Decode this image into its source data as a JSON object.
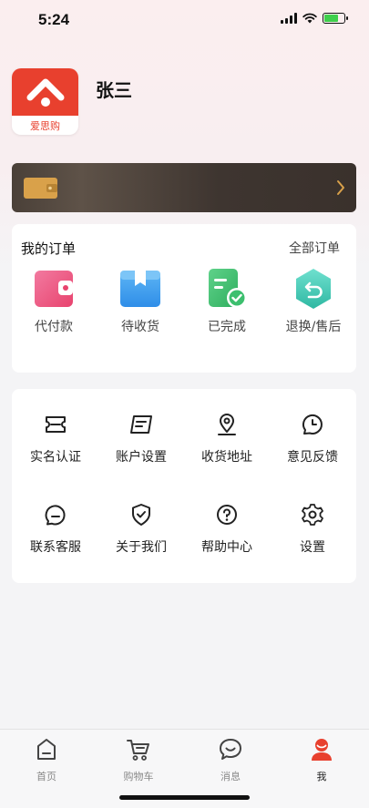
{
  "status_bar": {
    "time": "5:24"
  },
  "profile": {
    "avatar_text": "爱思购",
    "name": "张三"
  },
  "orders": {
    "title": "我的订单",
    "all_label": "全部订单",
    "items": [
      {
        "label": "代付款",
        "icon": "wallet-icon"
      },
      {
        "label": "待收货",
        "icon": "package-icon"
      },
      {
        "label": "已完成",
        "icon": "completed-icon"
      },
      {
        "label": "退换/售后",
        "icon": "return-icon"
      }
    ]
  },
  "services": {
    "items": [
      {
        "label": "实名认证",
        "icon": "id-card-icon"
      },
      {
        "label": "账户设置",
        "icon": "account-settings-icon"
      },
      {
        "label": "收货地址",
        "icon": "location-icon"
      },
      {
        "label": "意见反馈",
        "icon": "clock-icon"
      },
      {
        "label": "联系客服",
        "icon": "chat-icon"
      },
      {
        "label": "关于我们",
        "icon": "shield-icon"
      },
      {
        "label": "帮助中心",
        "icon": "help-icon"
      },
      {
        "label": "设置",
        "icon": "gear-icon"
      }
    ]
  },
  "tab_bar": {
    "items": [
      {
        "label": "首页",
        "icon": "home-icon"
      },
      {
        "label": "购物车",
        "icon": "cart-icon"
      },
      {
        "label": "消息",
        "icon": "message-icon"
      },
      {
        "label": "我",
        "icon": "user-icon"
      }
    ],
    "active": "我"
  },
  "colors": {
    "brand_red": "#e8402e",
    "wallet_gold": "#d9a14a",
    "order_pink": "#ec4f7a",
    "order_blue": "#2f8ee8",
    "order_green": "#3cbf6e",
    "order_teal": "#3ec9b4"
  }
}
